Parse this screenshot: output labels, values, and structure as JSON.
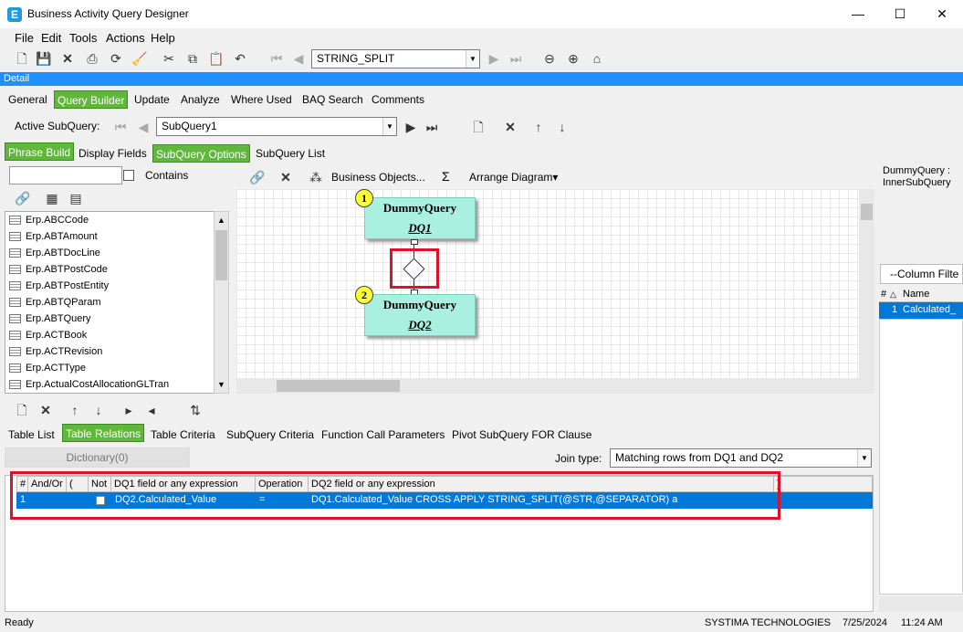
{
  "window": {
    "title": "Business Activity Query Designer",
    "app_icon": "E"
  },
  "menu": [
    "File",
    "Edit",
    "Tools",
    "Actions",
    "Help"
  ],
  "toolbar": {
    "query_combo_value": "STRING_SPLIT"
  },
  "detail_label": "Detail",
  "main_tabs": [
    "General",
    "Query Builder",
    "Update",
    "Analyze",
    "Where Used",
    "BAQ Search",
    "Comments"
  ],
  "active_subquery": {
    "label": "Active SubQuery:",
    "value": "SubQuery1"
  },
  "sub_tabs": [
    "Phrase Build",
    "Display Fields",
    "SubQuery Options",
    "SubQuery List"
  ],
  "table_search": {
    "contains_label": "Contains"
  },
  "tables": [
    "Erp.ABCCode",
    "Erp.ABTAmount",
    "Erp.ABTDocLine",
    "Erp.ABTPostCode",
    "Erp.ABTPostEntity",
    "Erp.ABTQParam",
    "Erp.ABTQuery",
    "Erp.ACTBook",
    "Erp.ACTRevision",
    "Erp.ACTType",
    "Erp.ActualCostAllocationGLTran"
  ],
  "diagram_toolbar": {
    "business_objects": "Business Objects...",
    "sigma": "Σ",
    "arrange": "Arrange Diagram"
  },
  "diagram": {
    "nodes": [
      {
        "badge": "1",
        "title": "DummyQuery",
        "alias": "DQ1"
      },
      {
        "badge": "2",
        "title": "DummyQuery",
        "alias": "DQ2"
      }
    ]
  },
  "right_panel": {
    "header_line1": "DummyQuery :",
    "header_line2": "InnerSubQuery",
    "filter_placeholder": "--Column Filte",
    "columns": [
      "#",
      "Name"
    ],
    "rows": [
      {
        "num": "1",
        "name": "Calculated_"
      }
    ]
  },
  "bottom_tabs": [
    "Table List",
    "Table Relations",
    "Table Criteria",
    "SubQuery Criteria",
    "Function Call Parameters",
    "Pivot SubQuery FOR Clause"
  ],
  "dictionary_button": "Dictionary(0)",
  "join": {
    "label": "Join type:",
    "value": "Matching rows from DQ1 and DQ2"
  },
  "relations_grid": {
    "columns": [
      "#",
      "And/Or",
      "(",
      "Not",
      "DQ1 field or any expression",
      "Operation",
      "DQ2 field or any expression",
      ")"
    ],
    "rows": [
      {
        "num": "1",
        "and_or": "",
        "paren_open": "",
        "not": false,
        "dq1": "DQ2.Calculated_Value",
        "operation": "=",
        "dq2": "DQ1.Calculated_Value CROSS APPLY STRING_SPLIT(@STR,@SEPARATOR) a"
      }
    ]
  },
  "status": {
    "left": "Ready",
    "company": "SYSTIMA TECHNOLOGIES",
    "date": "7/25/2024",
    "time": "11:24 AM"
  },
  "colors": {
    "accent_green": "#61b73c",
    "detail_blue": "#1e90ff",
    "selection_blue": "#0078d7",
    "highlight_red": "#e0102a",
    "node_fill": "#aaf0e0"
  }
}
